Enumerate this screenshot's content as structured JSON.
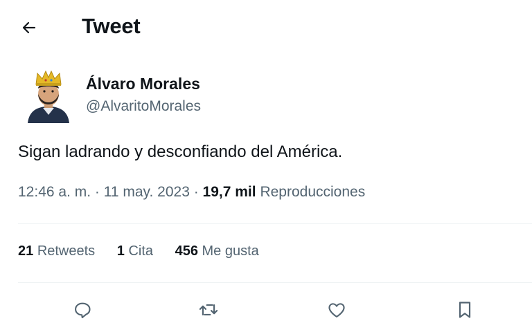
{
  "header": {
    "title": "Tweet",
    "back_icon": "arrow-left-icon"
  },
  "author": {
    "display_name": "Álvaro Morales",
    "handle": "@AlvaritoMorales",
    "avatar_icon": "crowned-avatar"
  },
  "tweet": {
    "text": "Sigan ladrando y desconfiando del América.",
    "time": "12:46 a. m.",
    "date": "11 may. 2023",
    "views_count": "19,7 mil",
    "views_label": "Reproducciones"
  },
  "stats": {
    "retweets_count": "21",
    "retweets_label": "Retweets",
    "quotes_count": "1",
    "quotes_label": "Cita",
    "likes_count": "456",
    "likes_label": "Me gusta"
  },
  "actions": {
    "icons": [
      "reply-icon",
      "retweet-icon",
      "like-icon",
      "bookmark-icon"
    ]
  },
  "colors": {
    "text": "#0f1419",
    "secondary": "#536471",
    "divider": "#eff3f4"
  }
}
